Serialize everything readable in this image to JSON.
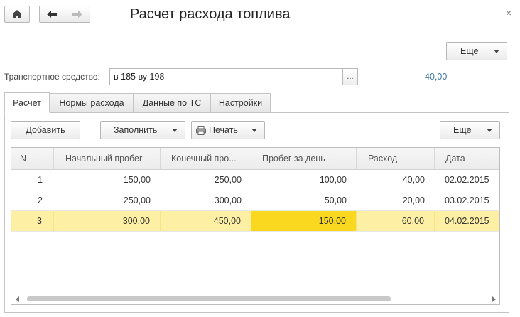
{
  "window": {
    "title": "Расчет расхода топлива",
    "close_glyph": "×"
  },
  "nav": {
    "home_glyph": "⌂",
    "back_glyph": "←",
    "forward_glyph": "→"
  },
  "header": {
    "more_label": "Еще"
  },
  "vehicle": {
    "label": "Транспортное средство:",
    "value": "в 185 ву 198",
    "select_glyph": "...",
    "total": "40,00"
  },
  "tabs": [
    {
      "label": "Расчет",
      "active": true
    },
    {
      "label": "Нормы расхода",
      "active": false
    },
    {
      "label": "Данные по ТС",
      "active": false
    },
    {
      "label": "Настройки",
      "active": false
    }
  ],
  "toolbar": {
    "add_label": "Добавить",
    "fill_label": "Заполнить",
    "print_label": "Печать",
    "more_label": "Еще"
  },
  "table": {
    "columns": [
      "N",
      "Начальный пробег",
      "Конечный про...",
      "Пробег за день",
      "Расход",
      "Дата"
    ],
    "rows": [
      {
        "n": "1",
        "start": "150,00",
        "end": "250,00",
        "day": "100,00",
        "consumption": "40,00",
        "date": "02.02.2015"
      },
      {
        "n": "2",
        "start": "250,00",
        "end": "300,00",
        "day": "50,00",
        "consumption": "20,00",
        "date": "03.02.2015"
      },
      {
        "n": "3",
        "start": "300,00",
        "end": "450,00",
        "day": "150,00",
        "consumption": "60,00",
        "date": "04.02.2015"
      }
    ],
    "selected_row": 3
  },
  "colors": {
    "selected_row": "#fdf0a4",
    "focused_cell": "#f9d81f",
    "total_value": "#3f78a8"
  }
}
